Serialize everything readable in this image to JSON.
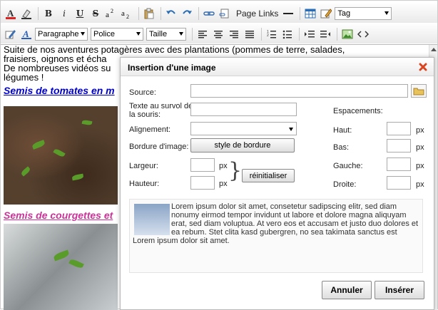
{
  "toolbar": {
    "row1": {
      "bold": "B",
      "italic": "i",
      "underline": "U",
      "strike": "S",
      "superscript": "a2",
      "subscript": "a2",
      "page_links": "Page Links",
      "tag_select": "Tag"
    },
    "row2": {
      "format_select": "Paragraphe",
      "font_select": "Police",
      "size_select": "Taille"
    }
  },
  "content": {
    "paragraph1_line1": "Suite de nos aventures potagères avec des plantations (pommes de terre, salades,",
    "paragraph1_line2": "fraisiers, oignons et écha",
    "paragraph1_line3": "De nombreuses vidéos su",
    "paragraph1_line4": "légumes !",
    "heading1": "Semis de tomates en m",
    "heading2": "Semis de courgettes et",
    "heading1_color": "#0000cc",
    "heading2_color": "#cc3399"
  },
  "dialog": {
    "title": "Insertion d'une image",
    "source_label": "Source:",
    "hover_text_label": "Texte au survol de la souris:",
    "alignment_label": "Alignement:",
    "border_label": "Bordure d'image:",
    "border_button": "style de bordure",
    "width_label": "Largeur:",
    "height_label": "Hauteur:",
    "px_unit": "px",
    "reset_button": "réinitialiser",
    "spacing_label": "Espacements:",
    "top_label": "Haut:",
    "bottom_label": "Bas:",
    "left_label": "Gauche:",
    "right_label": "Droite:",
    "preview_text": "Lorem ipsum dolor sit amet, consetetur sadipscing elitr, sed diam nonumy eirmod tempor invidunt ut labore et dolore magna aliquyam erat, sed diam voluptua. At vero eos et accusam et justo duo dolores et ea rebum. Stet clita kasd gubergren, no sea takimata sanctus est Lorem ipsum dolor sit amet.",
    "cancel_button": "Annuler",
    "insert_button": "Insérer"
  },
  "colors": {
    "close_icon": "#d9451f",
    "folder_icon": "#e8c25a"
  }
}
